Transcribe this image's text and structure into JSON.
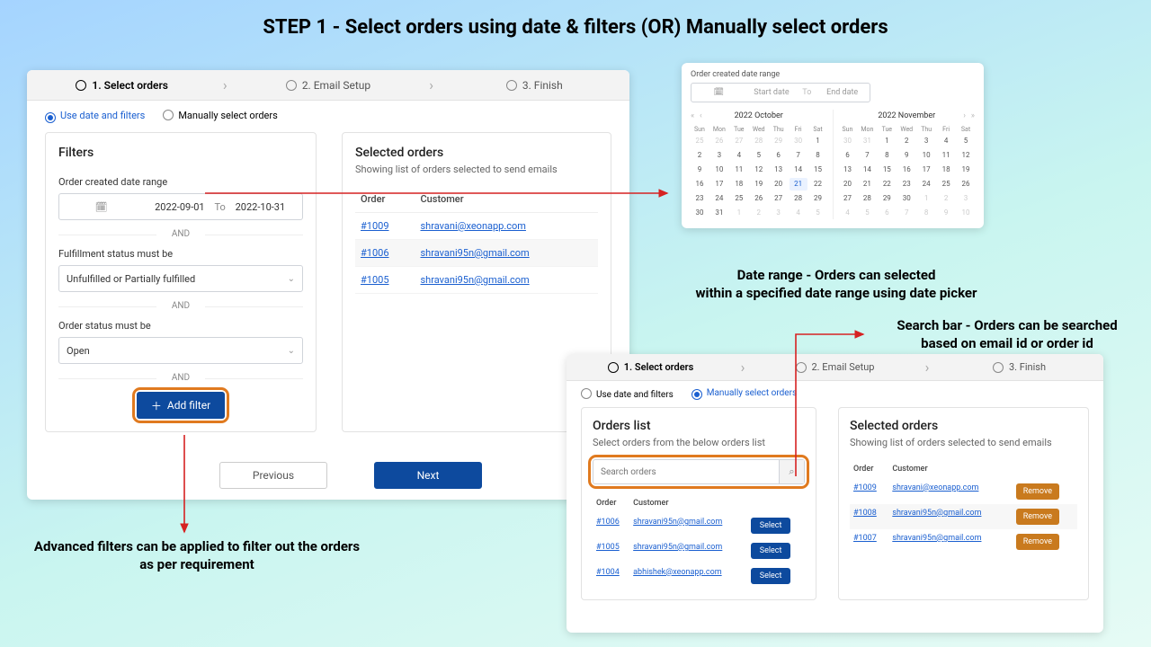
{
  "title": "STEP 1 - Select orders using date & filters (OR) Manually select orders",
  "wizard": {
    "s1": "1. Select orders",
    "s2": "2. Email Setup",
    "s3": "3. Finish"
  },
  "mode": {
    "a": "Use date and filters",
    "b": "Manually select orders"
  },
  "filters": {
    "title": "Filters",
    "dr_label": "Order created date range",
    "date_from": "2022-09-01",
    "to": "To",
    "date_to": "2022-10-31",
    "and": "AND",
    "f1_label": "Fulfillment status must be",
    "f1_val": "Unfulfilled or Partially fulfilled",
    "f2_label": "Order status must be",
    "f2_val": "Open",
    "add": "Add filter"
  },
  "selected": {
    "title": "Selected orders",
    "sub": "Showing list of orders selected to send emails",
    "col_order": "Order",
    "col_cust": "Customer",
    "rows": [
      {
        "o": "#1009",
        "c": "shravani@xeonapp.com"
      },
      {
        "o": "#1006",
        "c": "shravani95n@gmail.com"
      },
      {
        "o": "#1005",
        "c": "shravani95n@gmail.com"
      }
    ]
  },
  "nav": {
    "prev": "Previous",
    "next": "Next"
  },
  "cal": {
    "label": "Order created date range",
    "ph_start": "Start date",
    "to": "To",
    "ph_end": "End date",
    "m1": "2022 October",
    "m2": "2022 November",
    "dh": [
      "Sun",
      "Mon",
      "Tue",
      "Wed",
      "Thu",
      "Fri",
      "Sat"
    ]
  },
  "p3_list": {
    "title": "Orders list",
    "sub": "Select orders from the below orders list",
    "search_ph": "Search orders",
    "col_order": "Order",
    "col_cust": "Customer",
    "select": "Select",
    "rows": [
      {
        "o": "#1006",
        "c": "shravani95n@gmail.com"
      },
      {
        "o": "#1005",
        "c": "shravani95n@gmail.com"
      },
      {
        "o": "#1004",
        "c": "abhishek@xeonapp.com"
      }
    ]
  },
  "p3_sel": {
    "title": "Selected orders",
    "sub": "Showing list of orders selected to send emails",
    "col_order": "Order",
    "col_cust": "Customer",
    "remove": "Remove",
    "rows": [
      {
        "o": "#1009",
        "c": "shravani@xeonapp.com"
      },
      {
        "o": "#1008",
        "c": "shravani95n@gmail.com"
      },
      {
        "o": "#1007",
        "c": "shravani95n@gmail.com"
      }
    ]
  },
  "ann": {
    "a1": "Date range - Orders can selected\nwithin a specified date range using date picker",
    "a2": "Search bar - Orders can be searched\nbased on email id or order id",
    "a3": "Advanced filters can be applied to filter out the orders\nas per requirement"
  }
}
